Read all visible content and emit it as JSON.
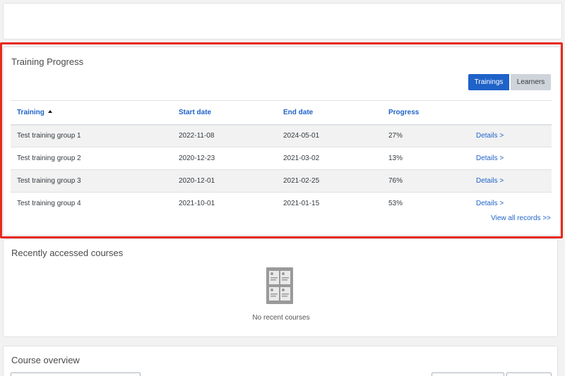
{
  "progress": {
    "title": "Training Progress",
    "toggle": {
      "trainings": "Trainings",
      "learners": "Learners",
      "active": "trainings"
    },
    "columns": [
      "Training",
      "Start date",
      "End date",
      "Progress"
    ],
    "rows": [
      {
        "name": "Test training group 1",
        "start": "2022-11-08",
        "end": "2024-05-01",
        "progress": "27%",
        "action": "Details >"
      },
      {
        "name": "Test training group 2",
        "start": "2020-12-23",
        "end": "2021-03-02",
        "progress": "13%",
        "action": "Details >"
      },
      {
        "name": "Test training group 3",
        "start": "2020-12-01",
        "end": "2021-02-25",
        "progress": "76%",
        "action": "Details >"
      },
      {
        "name": "Test training group 4",
        "start": "2021-10-01",
        "end": "2021-01-15",
        "progress": "53%",
        "action": "Details >"
      }
    ],
    "view_all": "View all records >>"
  },
  "recent": {
    "title": "Recently accessed courses",
    "empty": "No recent courses"
  },
  "overview": {
    "title": "Course overview"
  },
  "colors": {
    "accent": "#1f62c8",
    "highlight": "#e8291c",
    "stripe": "#f2f2f2"
  }
}
